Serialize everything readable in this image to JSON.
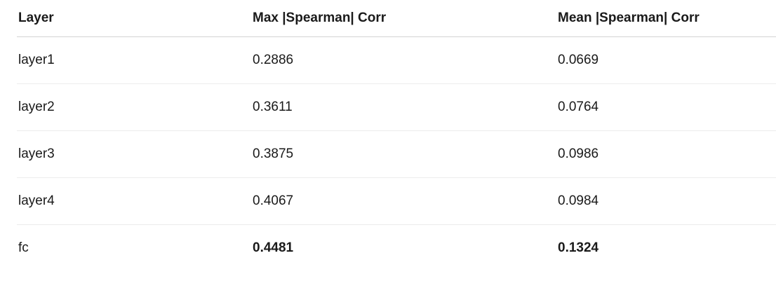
{
  "table": {
    "headers": [
      "Layer",
      "Max |Spearman| Corr",
      "Mean |Spearman| Corr"
    ],
    "rows": [
      {
        "layer": "layer1",
        "max": "0.2886",
        "mean": "0.0669"
      },
      {
        "layer": "layer2",
        "max": "0.3611",
        "mean": "0.0764"
      },
      {
        "layer": "layer3",
        "max": "0.3875",
        "mean": "0.0986"
      },
      {
        "layer": "layer4",
        "max": "0.4067",
        "mean": "0.0984"
      },
      {
        "layer": "fc",
        "max": "0.4481",
        "mean": "0.1324"
      }
    ],
    "bold_row_index": 4
  }
}
